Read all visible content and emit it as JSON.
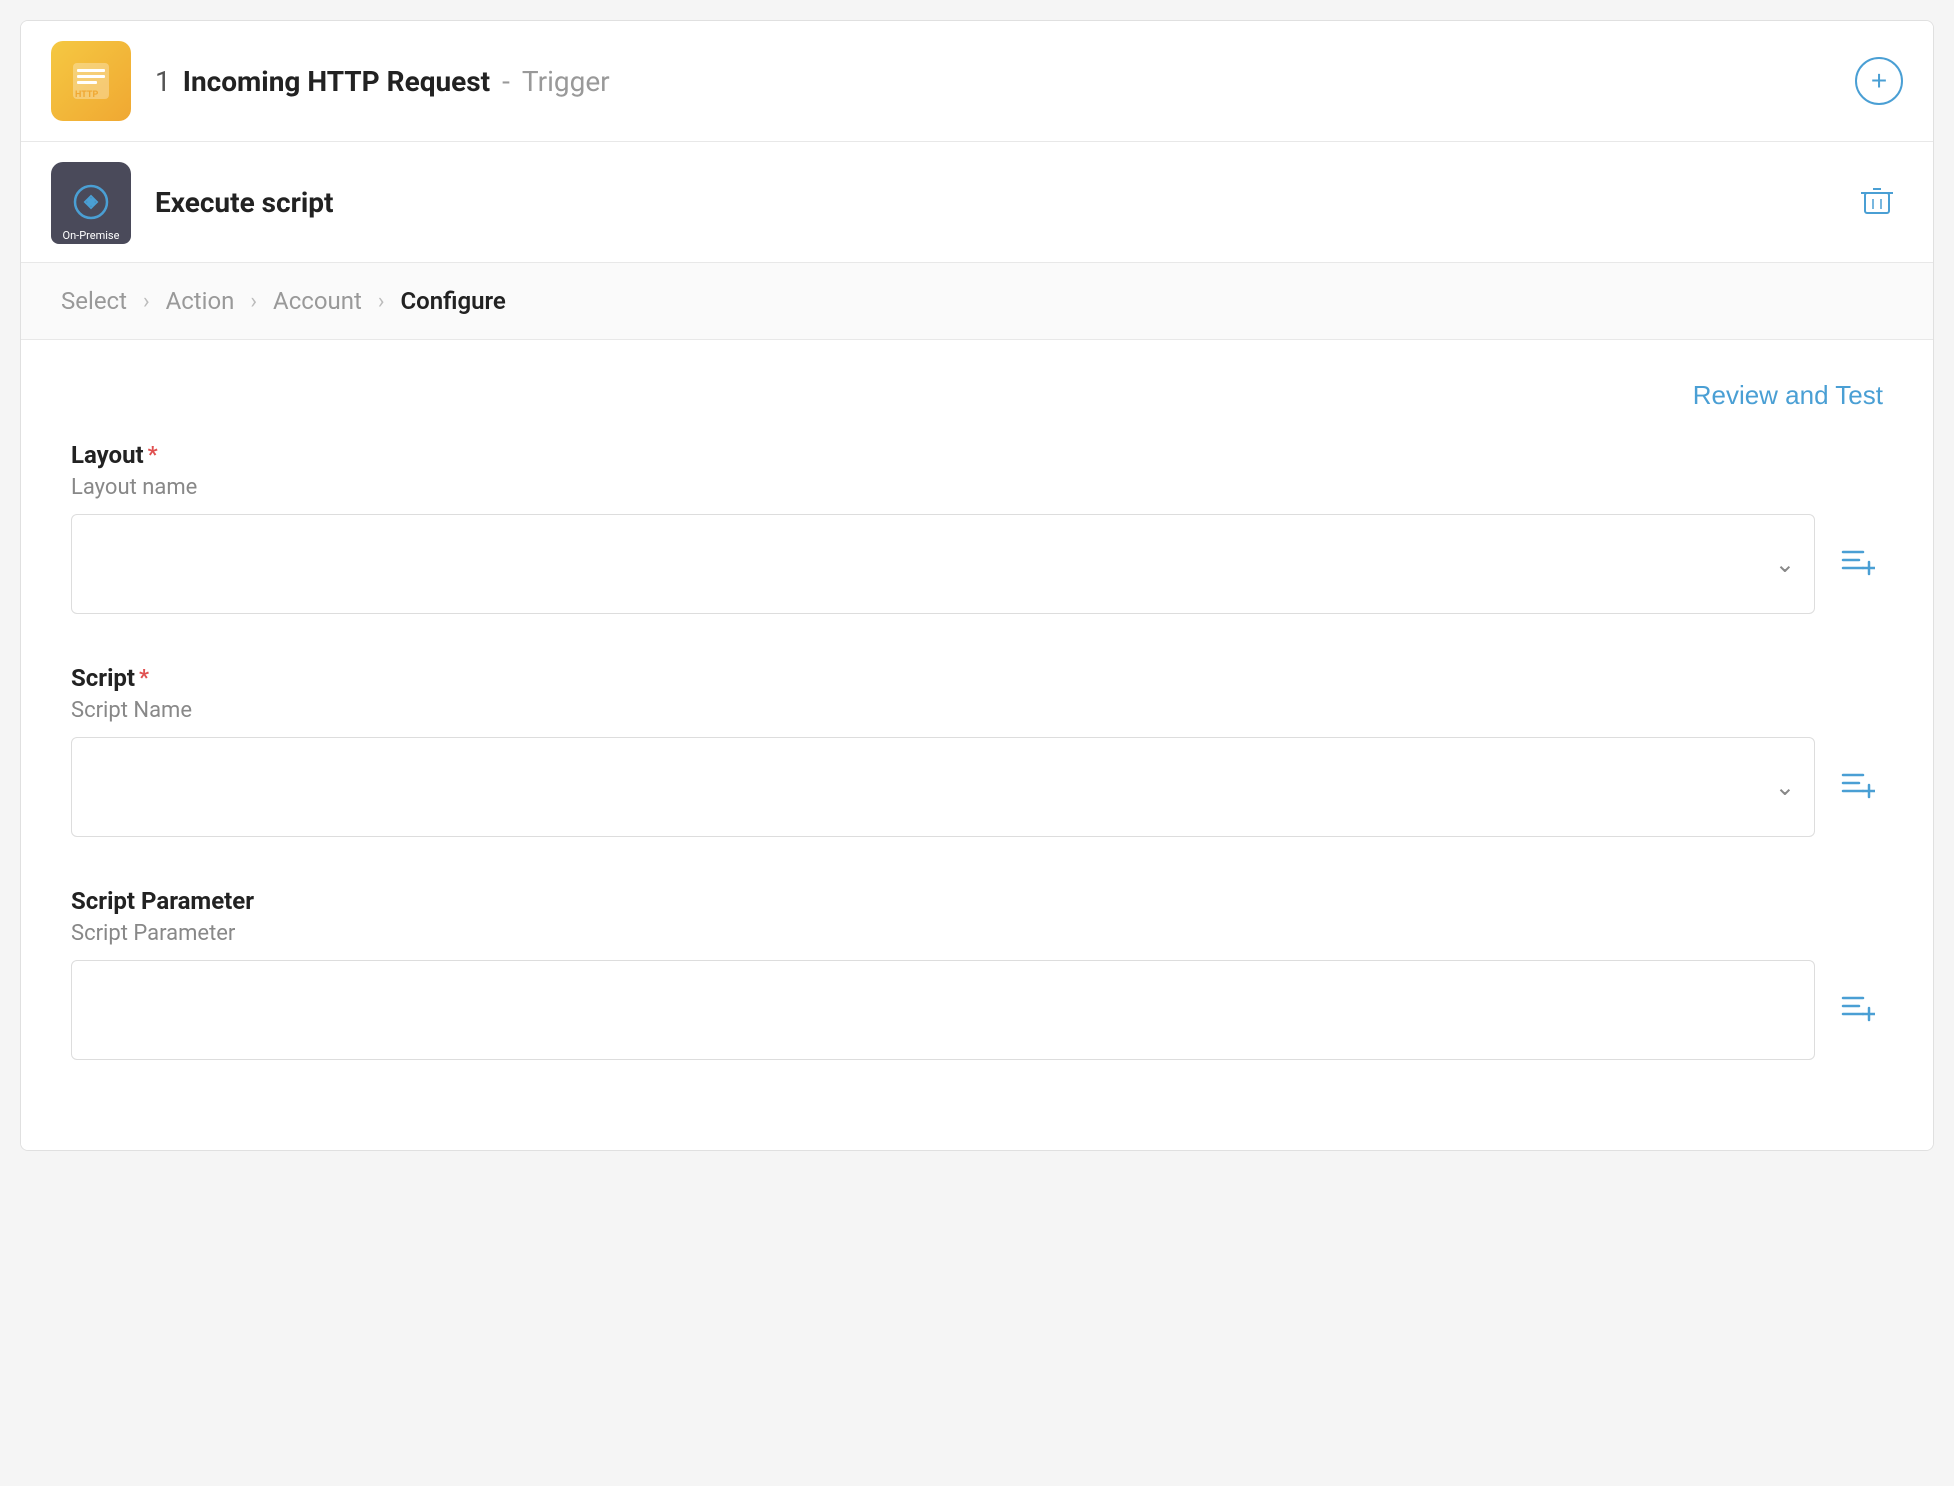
{
  "trigger": {
    "step_number": "1",
    "name": "Incoming HTTP Request",
    "separator": "-",
    "type": "Trigger"
  },
  "execute_script": {
    "title": "Execute script",
    "badge": "On-Premise"
  },
  "breadcrumb": {
    "steps": [
      {
        "id": "select",
        "label": "Select",
        "active": false
      },
      {
        "id": "action",
        "label": "Action",
        "active": false
      },
      {
        "id": "account",
        "label": "Account",
        "active": false
      },
      {
        "id": "configure",
        "label": "Configure",
        "active": true
      }
    ]
  },
  "configure": {
    "review_test_label": "Review and Test",
    "fields": [
      {
        "id": "layout",
        "label": "Layout",
        "required": true,
        "sublabel": "Layout name",
        "placeholder": ""
      },
      {
        "id": "script",
        "label": "Script",
        "required": true,
        "sublabel": "Script Name",
        "placeholder": ""
      },
      {
        "id": "script_parameter",
        "label": "Script Parameter",
        "required": false,
        "sublabel": "Script Parameter",
        "placeholder": ""
      }
    ]
  },
  "icons": {
    "add": "+",
    "chevron_down": "⌄",
    "chevron_right": "›",
    "required_star": "*"
  }
}
